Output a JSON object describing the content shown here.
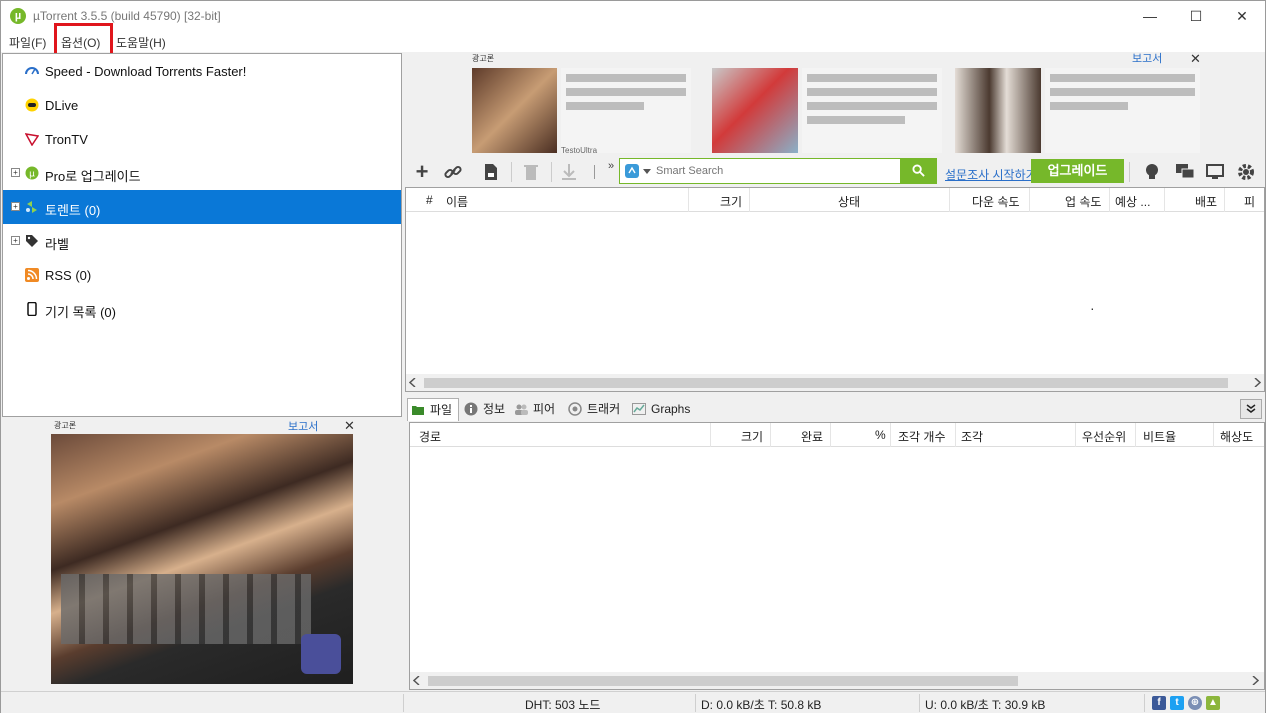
{
  "window": {
    "title": "µTorrent 3.5.5  (build 45790) [32-bit]",
    "logo_glyph": "µ",
    "minimize_glyph": "—",
    "maximize_glyph": "☐",
    "close_glyph": "✕"
  },
  "menubar": {
    "items": [
      "파일(F)",
      "옵션(O)",
      "도움말(H)"
    ],
    "highlight_color": "#e0161c"
  },
  "sidebar": {
    "items": [
      {
        "label": "Speed - Download Torrents Faster!",
        "icon": "speed-icon"
      },
      {
        "label": "DLive",
        "icon": "dlive-icon"
      },
      {
        "label": "TronTV",
        "icon": "trontv-icon"
      },
      {
        "label": "Pro로 업그레이드",
        "icon": "utorrent-pro-icon",
        "expandable": true
      },
      {
        "label": "토렌트 (0)",
        "icon": "torrents-icon",
        "expandable": true,
        "selected": true
      },
      {
        "label": "라벨",
        "icon": "label-tag-icon",
        "expandable": true
      },
      {
        "label": "RSS (0)",
        "icon": "rss-icon"
      },
      {
        "label": "기기 목록 (0)",
        "icon": "device-icon"
      }
    ],
    "expand_glyph": "+",
    "selected_color": "#0a78d7"
  },
  "ads": {
    "left": {
      "label": "광고론",
      "report": "보고서",
      "close": "✕"
    },
    "top": {
      "label": "광고론",
      "report": "보고서",
      "close": "✕",
      "tile_caption": "TestoUltra"
    }
  },
  "toolbar": {
    "add_glyph": "+",
    "more_glyph": "»",
    "search_placeholder": "Smart Search",
    "search_go_glyph": "⚲",
    "survey_link": "설문조사 시작하기",
    "upgrade_label": "업그레이드",
    "accent": "#76b82a"
  },
  "torrent_list": {
    "columns": [
      "#",
      "이름",
      "크기",
      "상태",
      "다운 속도",
      "업 속도",
      "예상 ...",
      "배포",
      "피"
    ],
    "placeholder_dot": "·"
  },
  "detail_tabs": {
    "tabs": [
      "파일",
      "정보",
      "피어",
      "트래커",
      "Graphs"
    ],
    "collapse_glyph": "⌄"
  },
  "file_list": {
    "columns": [
      "경로",
      "크기",
      "완료",
      "%",
      "조각 개수",
      "조각",
      "우선순위",
      "비트율",
      "해상도"
    ]
  },
  "statusbar": {
    "dht": "DHT: 503 노드",
    "download": "D: 0.0 kB/초 T: 50.8 kB",
    "upload": "U: 0.0 kB/초 T: 30.9 kB",
    "social": [
      "f",
      "t",
      "⊕",
      "▲"
    ]
  }
}
